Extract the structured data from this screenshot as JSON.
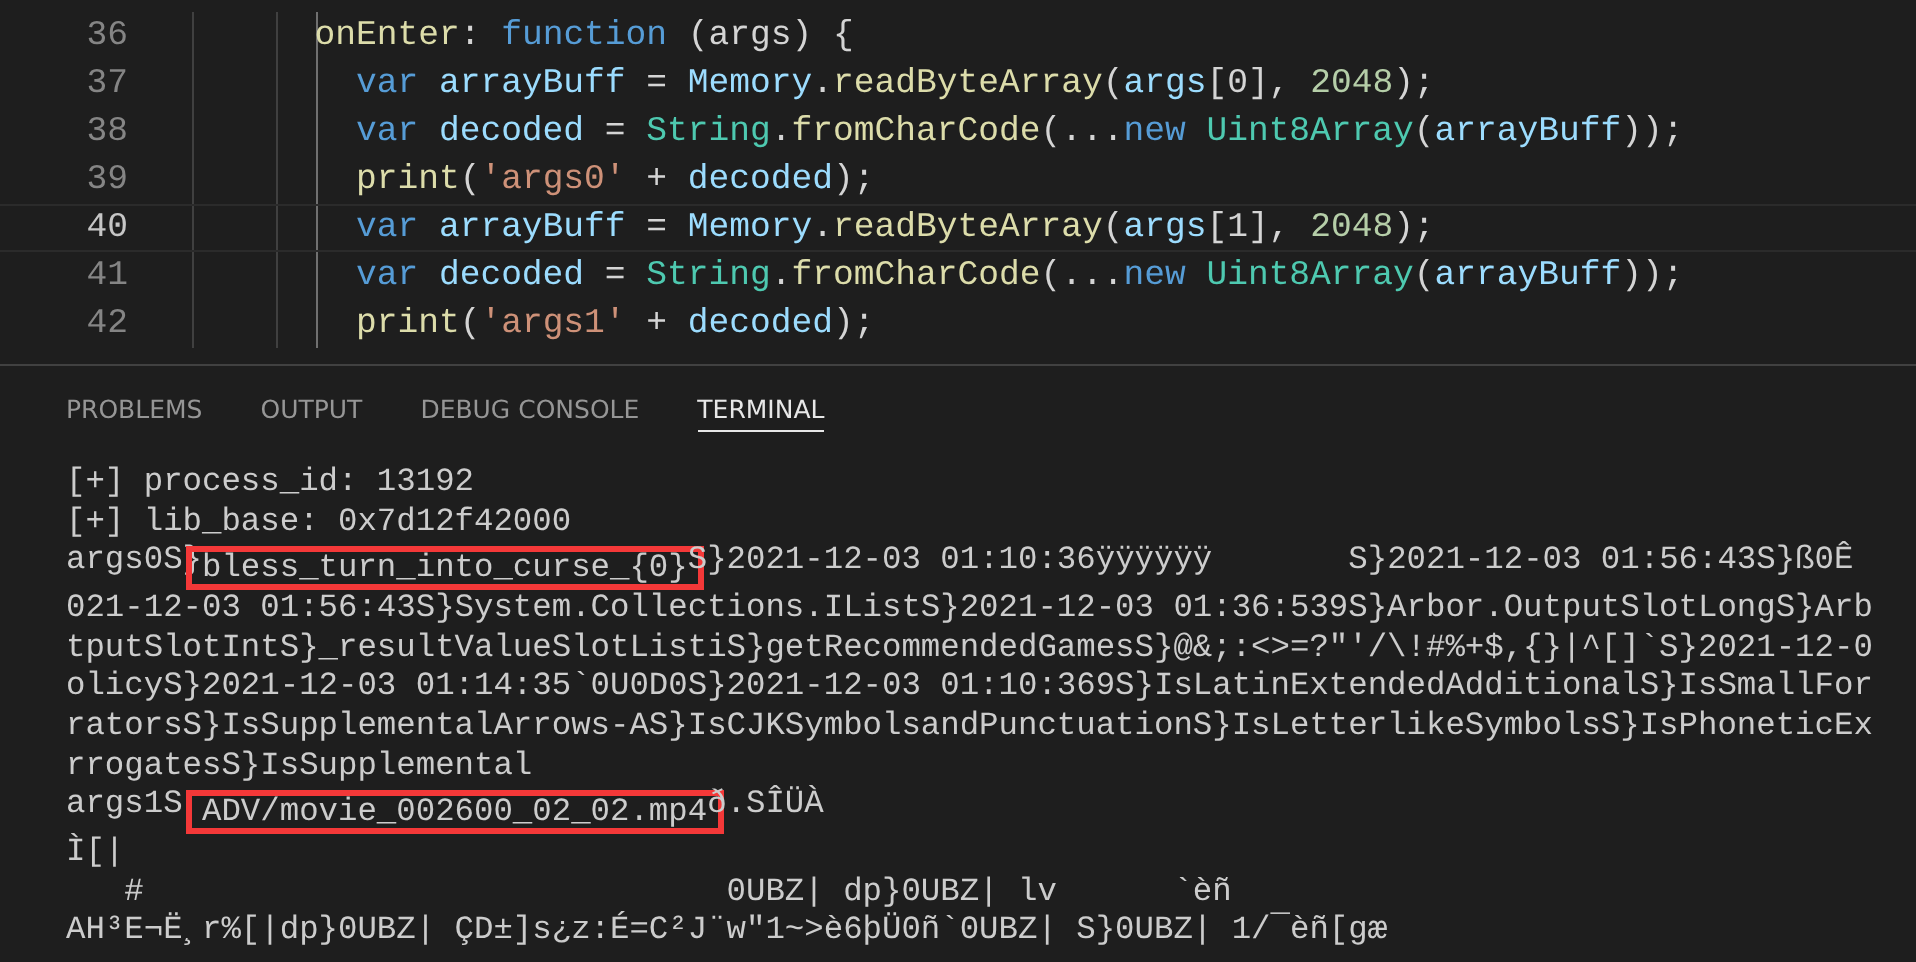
{
  "editor": {
    "lines": [
      {
        "number": "36",
        "current": false,
        "tokens": [
          {
            "kind": "function",
            "text": "      onEnter"
          },
          {
            "kind": "plain",
            "text": ": "
          },
          {
            "kind": "keyword",
            "text": "function"
          },
          {
            "kind": "plain",
            "text": " (args) {"
          }
        ]
      },
      {
        "number": "37",
        "current": false,
        "tokens": [
          {
            "kind": "keyword",
            "text": "        var "
          },
          {
            "kind": "variable",
            "text": "arrayBuff"
          },
          {
            "kind": "plain",
            "text": " = "
          },
          {
            "kind": "variable",
            "text": "Memory"
          },
          {
            "kind": "plain",
            "text": "."
          },
          {
            "kind": "function",
            "text": "readByteArray"
          },
          {
            "kind": "plain",
            "text": "("
          },
          {
            "kind": "variable",
            "text": "args"
          },
          {
            "kind": "plain",
            "text": "[0], "
          },
          {
            "kind": "number",
            "text": "2048"
          },
          {
            "kind": "plain",
            "text": ");"
          }
        ]
      },
      {
        "number": "38",
        "current": false,
        "tokens": [
          {
            "kind": "keyword",
            "text": "        var "
          },
          {
            "kind": "variable",
            "text": "decoded"
          },
          {
            "kind": "plain",
            "text": " = "
          },
          {
            "kind": "class",
            "text": "String"
          },
          {
            "kind": "plain",
            "text": "."
          },
          {
            "kind": "function",
            "text": "fromCharCode"
          },
          {
            "kind": "plain",
            "text": "(..."
          },
          {
            "kind": "keyword",
            "text": "new "
          },
          {
            "kind": "class",
            "text": "Uint8Array"
          },
          {
            "kind": "plain",
            "text": "("
          },
          {
            "kind": "variable",
            "text": "arrayBuff"
          },
          {
            "kind": "plain",
            "text": "));"
          }
        ]
      },
      {
        "number": "39",
        "current": false,
        "tokens": [
          {
            "kind": "function",
            "text": "        print"
          },
          {
            "kind": "plain",
            "text": "("
          },
          {
            "kind": "string",
            "text": "'args0'"
          },
          {
            "kind": "plain",
            "text": " + "
          },
          {
            "kind": "variable",
            "text": "decoded"
          },
          {
            "kind": "plain",
            "text": ");"
          }
        ]
      },
      {
        "number": "40",
        "current": true,
        "tokens": [
          {
            "kind": "keyword",
            "text": "        var "
          },
          {
            "kind": "variable",
            "text": "arrayBuff"
          },
          {
            "kind": "plain",
            "text": " = "
          },
          {
            "kind": "variable",
            "text": "Memory"
          },
          {
            "kind": "plain",
            "text": "."
          },
          {
            "kind": "function",
            "text": "readByteArray"
          },
          {
            "kind": "plain",
            "text": "("
          },
          {
            "kind": "variable",
            "text": "args"
          },
          {
            "kind": "plain",
            "text": "[1], "
          },
          {
            "kind": "number",
            "text": "2048"
          },
          {
            "kind": "plain",
            "text": ");"
          }
        ]
      },
      {
        "number": "41",
        "current": false,
        "tokens": [
          {
            "kind": "keyword",
            "text": "        var "
          },
          {
            "kind": "variable",
            "text": "decoded"
          },
          {
            "kind": "plain",
            "text": " = "
          },
          {
            "kind": "class",
            "text": "String"
          },
          {
            "kind": "plain",
            "text": "."
          },
          {
            "kind": "function",
            "text": "fromCharCode"
          },
          {
            "kind": "plain",
            "text": "(..."
          },
          {
            "kind": "keyword",
            "text": "new "
          },
          {
            "kind": "class",
            "text": "Uint8Array"
          },
          {
            "kind": "plain",
            "text": "("
          },
          {
            "kind": "variable",
            "text": "arrayBuff"
          },
          {
            "kind": "plain",
            "text": "));"
          }
        ]
      },
      {
        "number": "42",
        "current": false,
        "tokens": [
          {
            "kind": "function",
            "text": "        print"
          },
          {
            "kind": "plain",
            "text": "("
          },
          {
            "kind": "string",
            "text": "'args1'"
          },
          {
            "kind": "plain",
            "text": " + "
          },
          {
            "kind": "variable",
            "text": "decoded"
          },
          {
            "kind": "plain",
            "text": ");"
          }
        ]
      }
    ]
  },
  "panel": {
    "tabs": [
      {
        "label": "PROBLEMS",
        "selected": false
      },
      {
        "label": "OUTPUT",
        "selected": false
      },
      {
        "label": "DEBUG CONSOLE",
        "selected": false
      },
      {
        "label": "TERMINAL",
        "selected": true
      }
    ]
  },
  "terminal": {
    "lines": [
      {
        "segments": [
          {
            "text": "[+] process_id: 13192",
            "highlighted": false
          }
        ]
      },
      {
        "segments": [
          {
            "text": "[+] lib_base: 0x7d12f42000",
            "highlighted": false
          }
        ]
      },
      {
        "segments": [
          {
            "text": "args0S}",
            "highlighted": false
          },
          {
            "text": "bless_turn_into_curse_{0}",
            "highlighted": true
          },
          {
            "text": "S}2021-12-03 01:10:36ÿÿÿÿÿÿ       S}2021-12-03 01:56:43S}ß0Ê",
            "highlighted": false
          }
        ]
      },
      {
        "segments": [
          {
            "text": "021-12-03 01:56:43S}System.Collections.IListS}2021-12-03 01:36:539S}Arbor.OutputSlotLongS}Arb",
            "highlighted": false
          }
        ]
      },
      {
        "segments": [
          {
            "text": "tputSlotIntS}_resultValueSlotListiS}getRecommendedGamesS}@&;:<>=?\"'/\\!#%+$,{}|^[]`S}2021-12-0",
            "highlighted": false
          }
        ]
      },
      {
        "segments": [
          {
            "text": "olicyS}2021-12-03 01:14:35`0U0D0S}2021-12-03 01:10:369S}IsLatinExtendedAdditionalS}IsSmallFor",
            "highlighted": false
          }
        ]
      },
      {
        "segments": [
          {
            "text": "ratorsS}IsSupplementalArrows-AS}IsCJKSymbolsandPunctuationS}IsLetterlikeSymbolsS}IsPhoneticEx",
            "highlighted": false
          }
        ]
      },
      {
        "segments": [
          {
            "text": "rrogatesS}IsSupplemental",
            "highlighted": false
          }
        ]
      },
      {
        "segments": [
          {
            "text": "args1S ",
            "highlighted": false
          },
          {
            "text": "ADV/movie_002600_02_02.mp4",
            "highlighted": true
          },
          {
            "text": "ð.SÎÜÀ",
            "highlighted": false
          }
        ]
      },
      {
        "segments": [
          {
            "text": "Ì[|",
            "highlighted": false
          }
        ]
      },
      {
        "segments": [
          {
            "text": "   #                              0UBZ| dp}0UBZ| lv      `èñ",
            "highlighted": false
          }
        ]
      },
      {
        "segments": [
          {
            "text": "AH³E¬Ë¸r%[|dp}0UBZ| ÇD±]s¿z:É=C²J¨w\"1~>è6þÜ0ñ`0UBZ| S}0UBZ| 1/¯èñ[gæ",
            "highlighted": false
          }
        ]
      }
    ]
  }
}
